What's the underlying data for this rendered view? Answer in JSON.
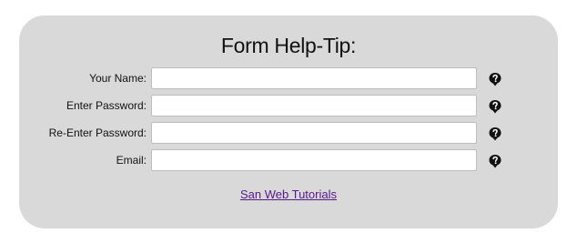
{
  "form": {
    "title": "Form Help-Tip:",
    "fields": [
      {
        "label": "Your Name:",
        "value": "",
        "type": "text"
      },
      {
        "label": "Enter Password:",
        "value": "",
        "type": "password"
      },
      {
        "label": "Re-Enter Password:",
        "value": "",
        "type": "password"
      },
      {
        "label": "Email:",
        "value": "",
        "type": "text"
      }
    ],
    "help_icon": "question-mark-bubble-icon",
    "link_text": "San Web Tutorials"
  },
  "colors": {
    "panel_bg": "#d9d9d9",
    "link": "#551a8b",
    "icon": "#111111"
  }
}
